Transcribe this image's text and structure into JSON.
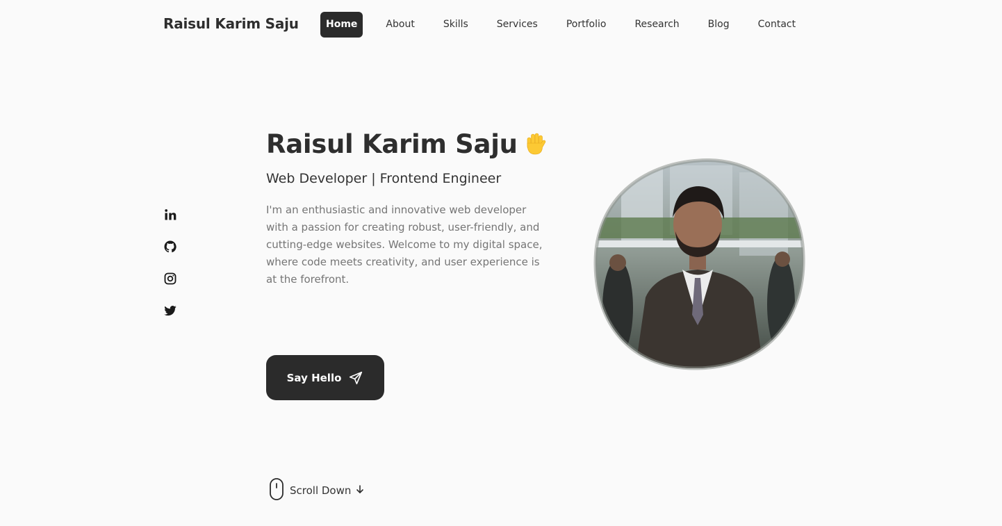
{
  "header": {
    "logo": "Raisul Karim Saju",
    "nav": [
      {
        "label": "Home",
        "active": true
      },
      {
        "label": "About",
        "active": false
      },
      {
        "label": "Skills",
        "active": false
      },
      {
        "label": "Services",
        "active": false
      },
      {
        "label": "Portfolio",
        "active": false
      },
      {
        "label": "Research",
        "active": false
      },
      {
        "label": "Blog",
        "active": false
      },
      {
        "label": "Contact",
        "active": false
      }
    ]
  },
  "socials": [
    {
      "icon": "linkedin-icon"
    },
    {
      "icon": "github-icon"
    },
    {
      "icon": "instagram-icon"
    },
    {
      "icon": "twitter-icon"
    }
  ],
  "hero": {
    "title": "Raisul Karim Saju",
    "wave_icon": "waving-hand-icon",
    "subtitle": "Web Developer | Frontend Engineer",
    "description": "I'm an enthusiastic and innovative web developer with a passion for creating robust, user-friendly, and cutting-edge websites. Welcome to my digital space, where code meets creativity, and user experience is at the forefront.",
    "button_label": "Say Hello",
    "button_icon": "send-icon",
    "scroll_label": "Scroll Down",
    "scroll_icon": "mouse-icon"
  },
  "colors": {
    "background": "#fafafa",
    "primary": "#2b2b2b",
    "text": "#333333",
    "muted": "#757575"
  }
}
